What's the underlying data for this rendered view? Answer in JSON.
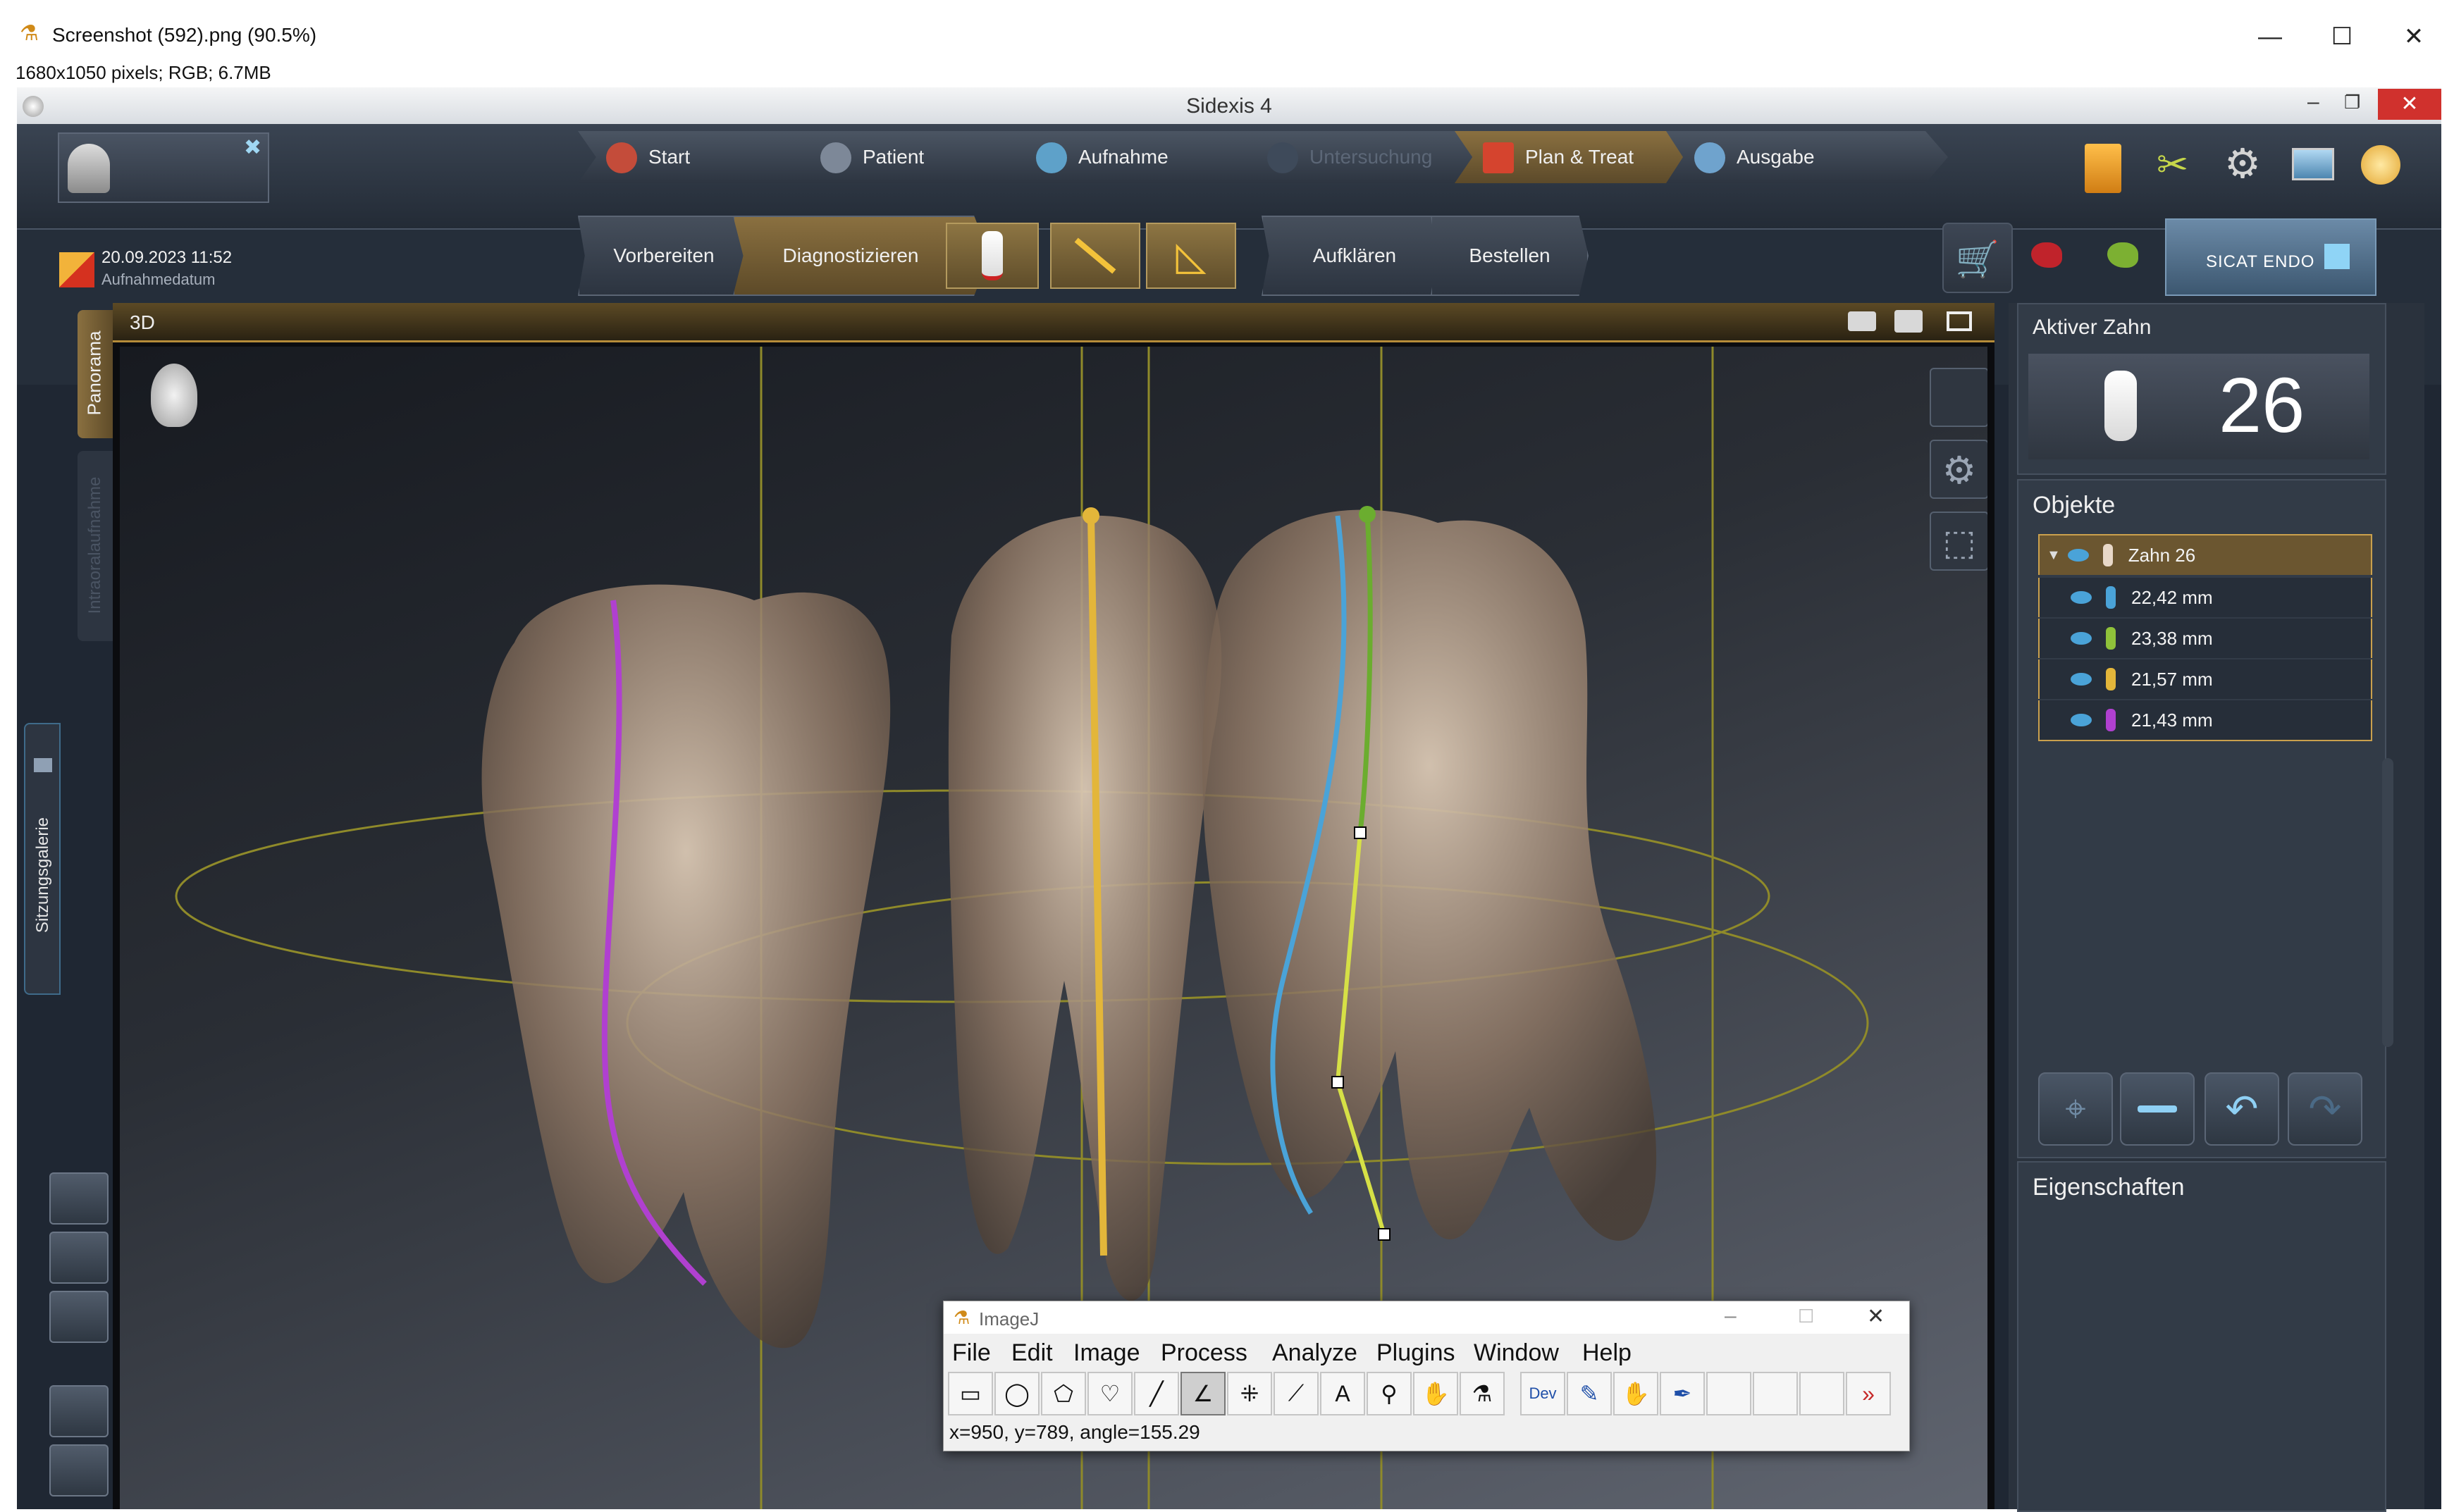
{
  "window": {
    "title": "Screenshot (592).png (90.5%)",
    "info": "1680x1050 pixels; RGB; 6.7MB"
  },
  "app": {
    "title": "Sidexis 4",
    "tabs": [
      {
        "label": "Start",
        "icon": "house-icon"
      },
      {
        "label": "Patient",
        "icon": "patient-icon"
      },
      {
        "label": "Aufnahme",
        "icon": "acquisition-icon"
      },
      {
        "label": "Untersuchung",
        "icon": "examination-icon"
      },
      {
        "label": "Plan & Treat",
        "icon": "plan-treat-icon"
      },
      {
        "label": "Ausgabe",
        "icon": "output-globe-icon"
      }
    ],
    "date": "20.09.2023 11:52",
    "date_caption": "Aufnahmedatum",
    "steps": [
      "Vorbereiten",
      "Diagnostizieren",
      "Aufklären",
      "Bestellen"
    ],
    "sicat_label": "SICAT ENDO",
    "side_tabs": [
      "Panorama",
      "Intraoralaufnahme",
      "Sitzungsgalerie"
    ],
    "viewport_title": "3D",
    "active_tooth_label": "Aktiver Zahn",
    "active_tooth_number": "26",
    "objects_title": "Objekte",
    "objects": [
      {
        "label": "Zahn 26",
        "color": "#e8d8c8"
      },
      {
        "label": "22,42 mm",
        "color": "#4aa3d8"
      },
      {
        "label": "23,38 mm",
        "color": "#8fc23a"
      },
      {
        "label": "21,57 mm",
        "color": "#e3b63a"
      },
      {
        "label": "21,43 mm",
        "color": "#b040d0"
      }
    ],
    "properties_title": "Eigenschaften"
  },
  "imagej": {
    "title": "ImageJ",
    "menu": [
      "File",
      "Edit",
      "Image",
      "Process",
      "Analyze",
      "Plugins",
      "Window",
      "Help"
    ],
    "tools": [
      "rectangle-tool-icon",
      "oval-tool-icon",
      "polygon-tool-icon",
      "freehand-tool-icon",
      "line-tool-icon",
      "angle-tool-icon",
      "multipoint-tool-icon",
      "wand-tool-icon",
      "text-tool-icon",
      "zoom-tool-icon",
      "hand-tool-icon",
      "dropper-tool-icon",
      "dev-tool-icon",
      "pencil-tool-icon",
      "brush-tool-icon",
      "pipette-tool-icon"
    ],
    "dev_label": "Dev",
    "status": "x=950, y=789, angle=155.29"
  }
}
